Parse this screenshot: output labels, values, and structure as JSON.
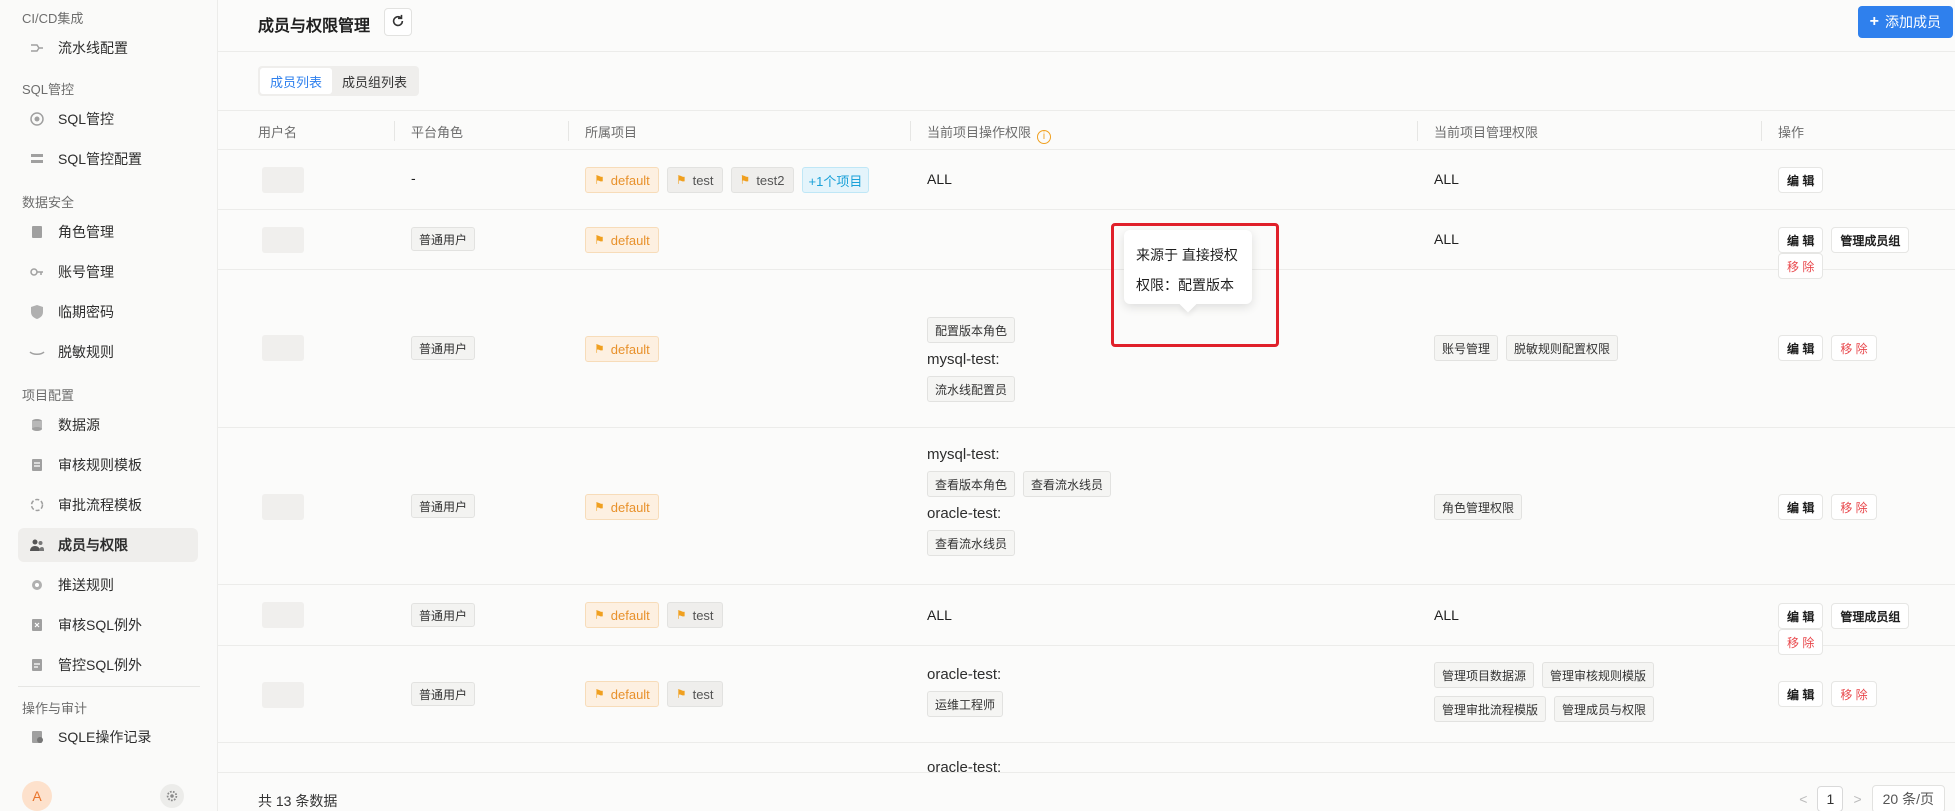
{
  "sidebar": {
    "groups": [
      {
        "title": "CI/CD集成",
        "items": [
          {
            "label": "流水线配置",
            "icon": "pipeline-icon"
          }
        ]
      },
      {
        "title": "SQL管控",
        "items": [
          {
            "label": "SQL管控",
            "icon": "sql-control-icon"
          },
          {
            "label": "SQL管控配置",
            "icon": "sql-config-icon"
          }
        ]
      },
      {
        "title": "数据安全",
        "items": [
          {
            "label": "角色管理",
            "icon": "role-icon"
          },
          {
            "label": "账号管理",
            "icon": "key-icon"
          },
          {
            "label": "临期密码",
            "icon": "shield-icon"
          },
          {
            "label": "脱敏规则",
            "icon": "mask-icon"
          }
        ]
      },
      {
        "title": "项目配置",
        "items": [
          {
            "label": "数据源",
            "icon": "database-icon"
          },
          {
            "label": "审核规则模板",
            "icon": "rule-template-icon"
          },
          {
            "label": "审批流程模板",
            "icon": "flow-icon"
          },
          {
            "label": "成员与权限",
            "icon": "members-icon",
            "active": true
          },
          {
            "label": "推送规则",
            "icon": "push-icon"
          },
          {
            "label": "审核SQL例外",
            "icon": "sql-exception-icon"
          },
          {
            "label": "管控SQL例外",
            "icon": "control-exception-icon"
          }
        ]
      },
      {
        "title": "操作与审计",
        "items": [
          {
            "label": "SQLE操作记录",
            "icon": "record-icon"
          }
        ]
      }
    ],
    "avatar_letter": "A"
  },
  "header": {
    "title": "成员与权限管理",
    "add_button": "添加成员"
  },
  "tabs": {
    "members": "成员列表",
    "groups": "成员组列表"
  },
  "table": {
    "columns": {
      "username": "用户名",
      "platform_role": "平台角色",
      "projects": "所属项目",
      "op_perms": "当前项目操作权限",
      "mgmt_perms": "当前项目管理权限",
      "actions": "操作"
    },
    "rows": [
      {
        "role": "-",
        "projects": [
          "default",
          "test",
          "test2"
        ],
        "more": "+1个项目",
        "op_text": "ALL",
        "mgmt_text": "ALL",
        "actions": [
          "编 辑"
        ]
      },
      {
        "role": "普通用户",
        "projects": [
          "default"
        ],
        "mgmt_text": "ALL",
        "actions": [
          "编 辑",
          "管理成员组",
          "移 除"
        ]
      },
      {
        "role": "普通用户",
        "projects": [
          "default"
        ],
        "op_tag1": "配置版本角色",
        "op_proj2": "mysql-test:",
        "op_tag2": "流水线配置员",
        "mgmt_tags": [
          "账号管理",
          "脱敏规则配置权限"
        ],
        "actions": [
          "编 辑",
          "移 除"
        ]
      },
      {
        "role": "普通用户",
        "projects": [
          "default"
        ],
        "op_proj1": "mysql-test:",
        "op_tags1": [
          "查看版本角色",
          "查看流水线员"
        ],
        "op_proj2": "oracle-test:",
        "op_tags2": [
          "查看流水线员"
        ],
        "mgmt_tags": [
          "角色管理权限"
        ],
        "actions": [
          "编 辑",
          "移 除"
        ]
      },
      {
        "role": "普通用户",
        "projects": [
          "default",
          "test"
        ],
        "op_text": "ALL",
        "mgmt_text": "ALL",
        "actions": [
          "编 辑",
          "管理成员组",
          "移 除"
        ]
      },
      {
        "role": "普通用户",
        "projects": [
          "default",
          "test"
        ],
        "op_proj1": "oracle-test:",
        "op_tags1": [
          "运维工程师"
        ],
        "mgmt_tags": [
          "管理项目数据源",
          "管理审核规则模版",
          "管理审批流程模版",
          "管理成员与权限"
        ],
        "actions": [
          "编 辑",
          "移 除"
        ]
      },
      {
        "op_proj1": "oracle-test:"
      }
    ]
  },
  "tooltip": {
    "line1": "来源于 直接授权",
    "line2": "权限：配置版本"
  },
  "footer": {
    "total": "共 13 条数据",
    "page": "1",
    "page_size": "20 条/页",
    "prev": "<",
    "next": ">"
  }
}
